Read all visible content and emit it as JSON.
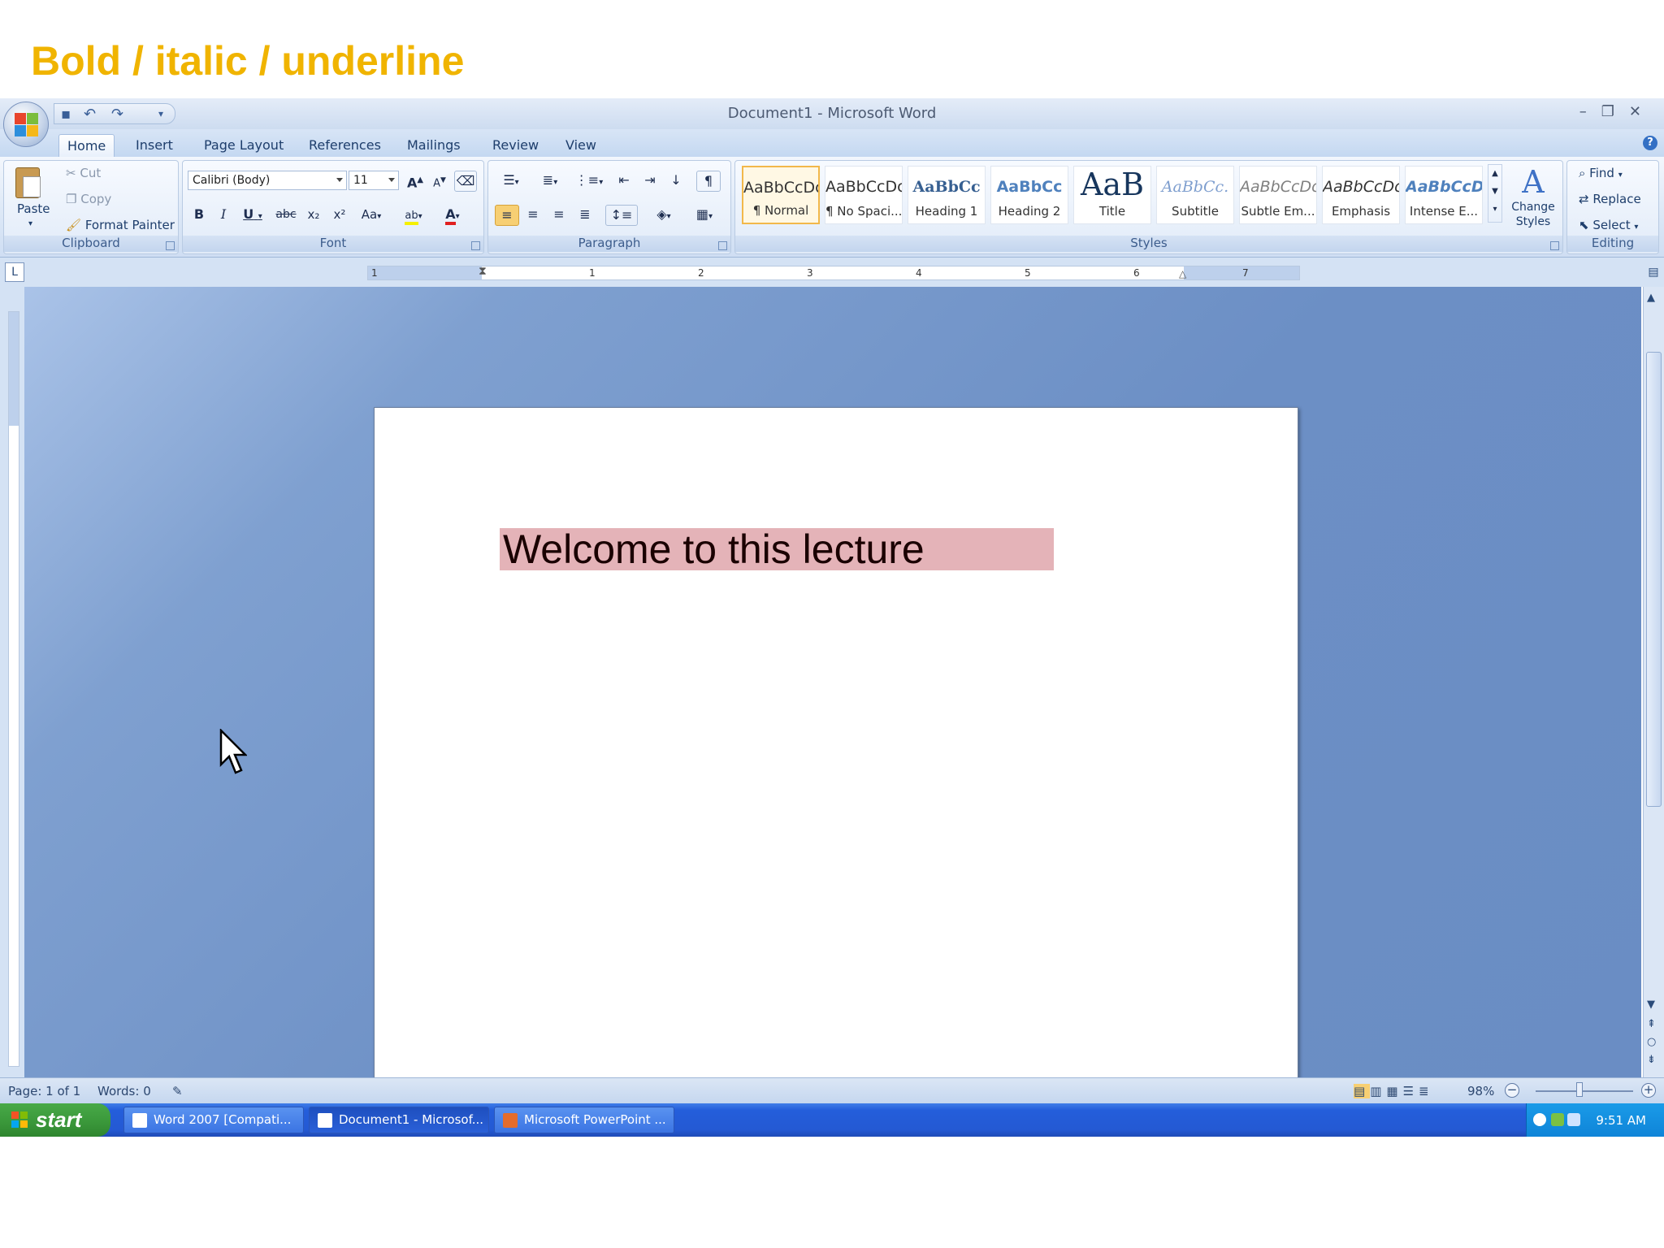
{
  "slide": {
    "title": "Bold / italic / underline"
  },
  "window": {
    "title": "Document1 - Microsoft Word"
  },
  "tabs": [
    "Home",
    "Insert",
    "Page Layout",
    "References",
    "Mailings",
    "Review",
    "View"
  ],
  "clipboard": {
    "paste": "Paste",
    "cut": "Cut",
    "copy": "Copy",
    "format_painter": "Format Painter",
    "label": "Clipboard"
  },
  "font": {
    "name": "Calibri (Body)",
    "size": "11",
    "label": "Font",
    "bold": "B",
    "italic": "I",
    "underline": "U",
    "strike": "abc",
    "subscript": "x₂",
    "superscript": "x²",
    "change_case": "Aa",
    "grow": "A",
    "shrink": "A"
  },
  "paragraph": {
    "label": "Paragraph"
  },
  "styles": {
    "label": "Styles",
    "items": [
      {
        "preview": "AaBbCcDc",
        "name": "¶ Normal"
      },
      {
        "preview": "AaBbCcDc",
        "name": "¶ No Spaci..."
      },
      {
        "preview": "AaBbCc",
        "name": "Heading 1"
      },
      {
        "preview": "AaBbCc",
        "name": "Heading 2"
      },
      {
        "preview": "AaB",
        "name": "Title"
      },
      {
        "preview": "AaBbCc.",
        "name": "Subtitle"
      },
      {
        "preview": "AaBbCcDc",
        "name": "Subtle Em..."
      },
      {
        "preview": "AaBbCcDc",
        "name": "Emphasis"
      },
      {
        "preview": "AaBbCcDc",
        "name": "Intense E..."
      }
    ],
    "change_styles": "Change Styles"
  },
  "editing": {
    "find": "Find",
    "replace": "Replace",
    "select": "Select",
    "label": "Editing"
  },
  "ruler": {
    "ticks": [
      "1",
      "1",
      "2",
      "3",
      "4",
      "5",
      "6",
      "7"
    ]
  },
  "document": {
    "text": "Welcome to this lecture"
  },
  "status": {
    "page": "Page: 1 of 1",
    "words": "Words: 0",
    "zoom": "98%"
  },
  "taskbar": {
    "start": "start",
    "tasks": [
      "Word 2007 [Compati...",
      "Document1 - Microsof...",
      "Microsoft PowerPoint ..."
    ],
    "clock": "9:51 AM"
  },
  "colors": {
    "slide_title": "#f0b400",
    "highlight": "#e4b3b8",
    "taskbar": "#245edb",
    "start": "#3c9a3c"
  }
}
